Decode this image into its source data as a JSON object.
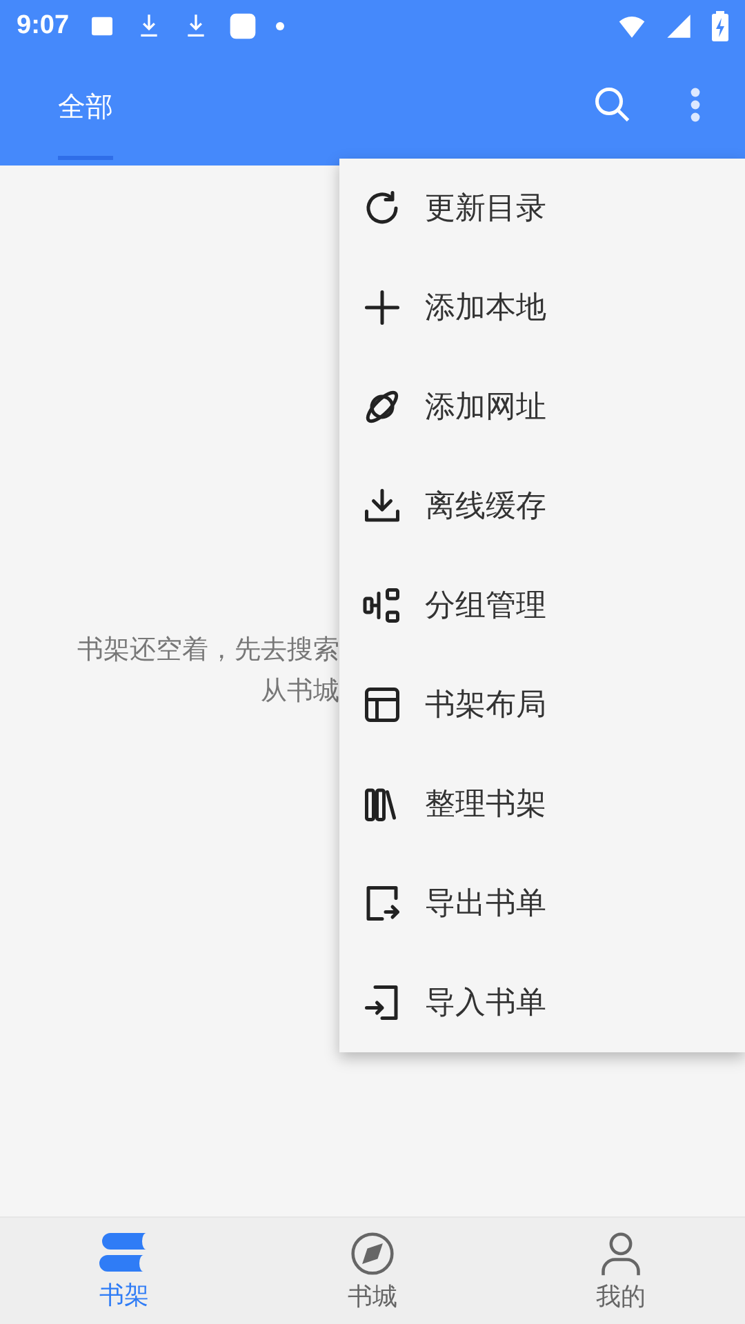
{
  "status_bar": {
    "time": "9:07"
  },
  "app_bar": {
    "tabs": [
      {
        "label": "全部",
        "selected": true
      }
    ]
  },
  "empty_message": [
    "书架还空着，先去搜索",
    "从书城"
  ],
  "menu": [
    {
      "label": "更新目录"
    },
    {
      "label": "添加本地"
    },
    {
      "label": "添加网址"
    },
    {
      "label": "离线缓存"
    },
    {
      "label": "分组管理"
    },
    {
      "label": "书架布局"
    },
    {
      "label": "整理书架"
    },
    {
      "label": "导出书单"
    },
    {
      "label": "导入书单"
    }
  ],
  "bottom_nav": [
    {
      "label": "书架",
      "selected": true
    },
    {
      "label": "书城",
      "selected": false
    },
    {
      "label": "我的",
      "selected": false
    }
  ]
}
